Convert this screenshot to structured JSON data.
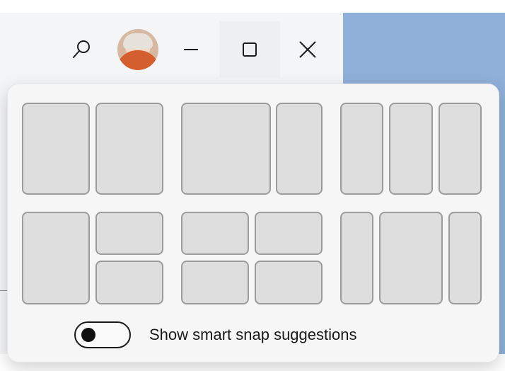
{
  "titlebar": {
    "icons": {
      "search": "search-icon",
      "avatar": "user-avatar",
      "minimize": "minimize-icon",
      "maximize": "maximize-icon",
      "close": "close-icon"
    }
  },
  "snap_flyout": {
    "layouts": [
      {
        "name": "two-equal-columns"
      },
      {
        "name": "wide-left-narrow-right"
      },
      {
        "name": "three-equal-columns"
      },
      {
        "name": "left-column-two-stacked-right"
      },
      {
        "name": "four-quadrants"
      },
      {
        "name": "narrow-wide-narrow-columns"
      }
    ],
    "toggle": {
      "label": "Show smart snap suggestions",
      "state": "off"
    }
  },
  "colors": {
    "zone_fill": "#dedede",
    "zone_border": "#9c9c9c",
    "flyout_bg": "#f6f6f7",
    "desktop_blue": "#8fb0d8"
  }
}
